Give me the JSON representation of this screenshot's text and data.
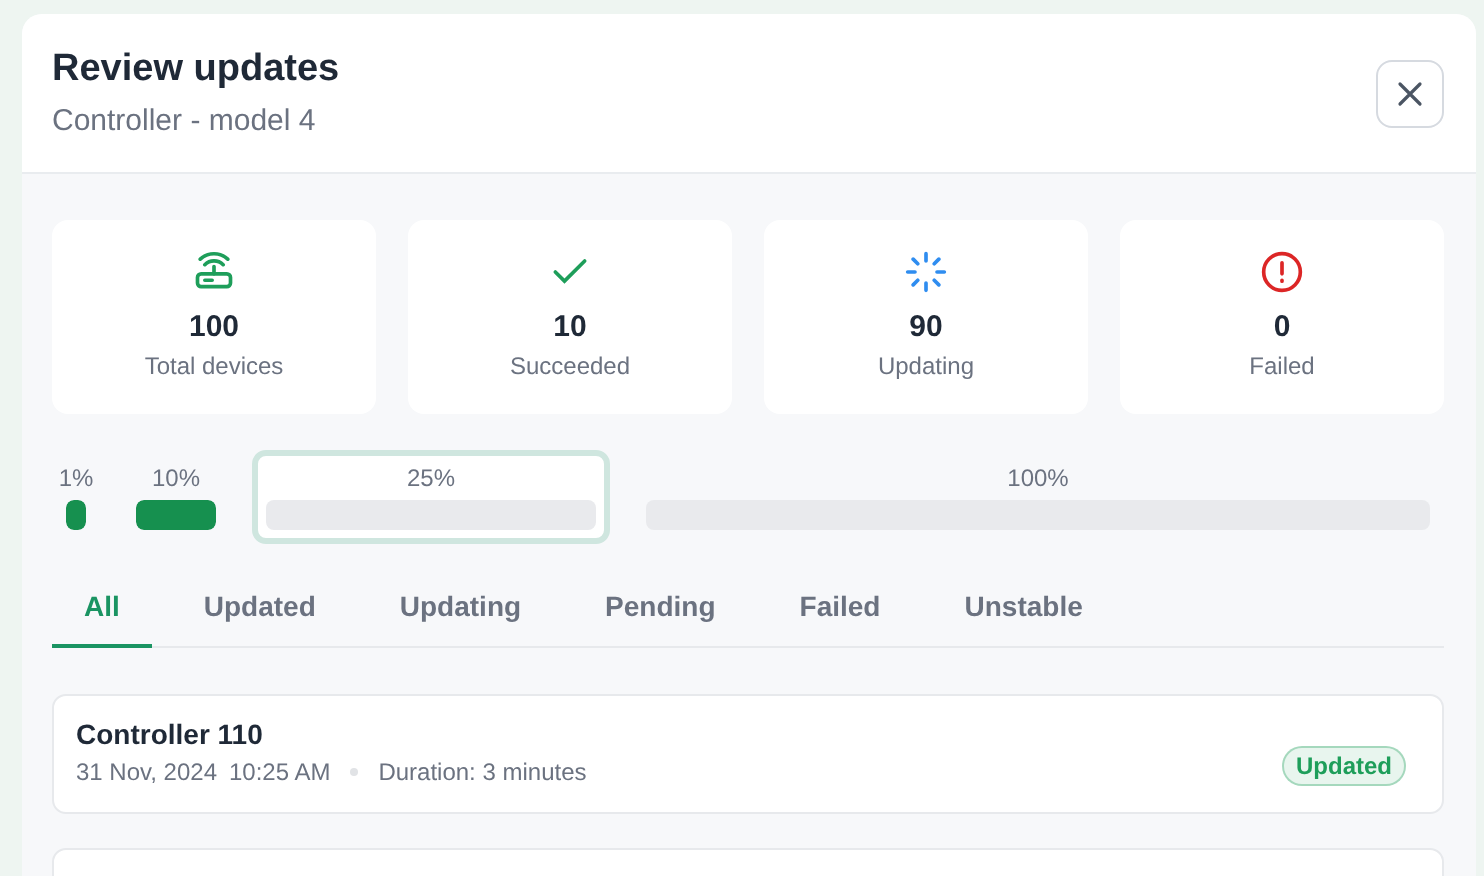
{
  "dialog": {
    "title": "Review updates",
    "subtitle": "Controller - model 4"
  },
  "stats": [
    {
      "kind": "devices",
      "value": "100",
      "label": "Total devices"
    },
    {
      "kind": "success",
      "value": "10",
      "label": "Succeeded"
    },
    {
      "kind": "updating",
      "value": "90",
      "label": "Updating"
    },
    {
      "kind": "failed",
      "value": "0",
      "label": "Failed"
    }
  ],
  "rollout_steps": [
    {
      "label": "1%",
      "level": 1,
      "selected": false
    },
    {
      "label": "10%",
      "level": 1,
      "selected": false
    },
    {
      "label": "25%",
      "level": 0,
      "selected": true
    },
    {
      "label": "100%",
      "level": 0,
      "selected": false
    }
  ],
  "tabs": [
    {
      "label": "All",
      "selected": true
    },
    {
      "label": "Updated",
      "selected": false
    },
    {
      "label": "Updating",
      "selected": false
    },
    {
      "label": "Pending",
      "selected": false
    },
    {
      "label": "Failed",
      "selected": false
    },
    {
      "label": "Unstable",
      "selected": false
    }
  ],
  "devices": [
    {
      "name": "Controller 110",
      "date": "31 Nov, 2024",
      "time": "10:25 AM",
      "duration": "Duration: 3 minutes",
      "status": "Updated",
      "color": "#1e9e5a"
    }
  ]
}
